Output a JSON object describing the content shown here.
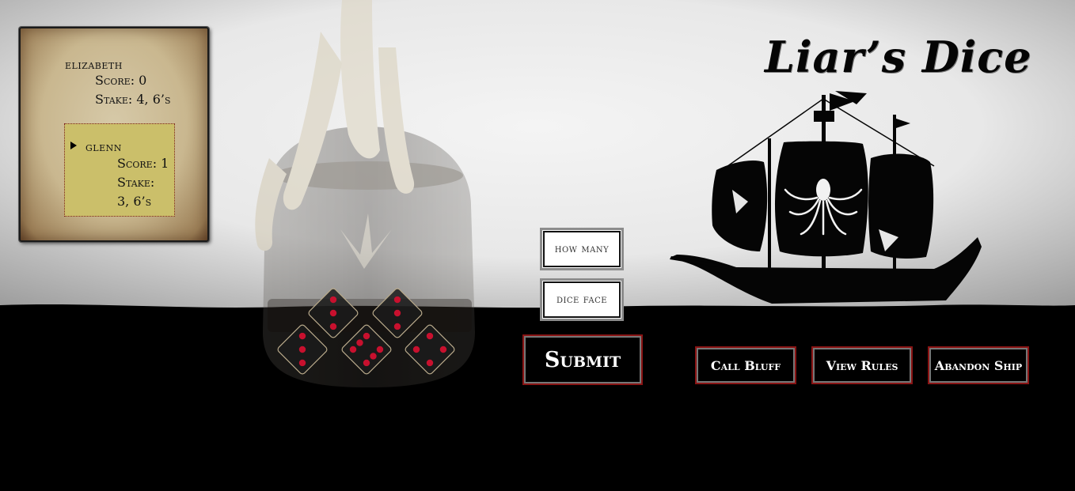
{
  "title": "Liar’s Dice",
  "players": [
    {
      "name": "elizabeth",
      "score_line": "Score: 0",
      "stake_label": "Stake:",
      "stake_value": "4, 6’s",
      "active": false
    },
    {
      "name": "glenn",
      "score_line": "Score: 1",
      "stake_label": "Stake:",
      "stake_value": "3, 6’s",
      "active": true
    }
  ],
  "bid": {
    "how_many_placeholder": "how many",
    "dice_face_placeholder": "dice face",
    "submit_label": "Submit"
  },
  "actions": {
    "call_bluff": "Call Bluff",
    "view_rules": "View Rules",
    "abandon_ship": "Abandon Ship"
  },
  "dice": [
    {
      "value": 3
    },
    {
      "value": 3
    },
    {
      "value": 3
    },
    {
      "value": 6
    },
    {
      "value": 4
    }
  ],
  "icons": {
    "turn": "turn-arrow-icon",
    "ship": "pirate-ship-icon",
    "kraken": "kraken-emblem-icon",
    "bottle": "skeleton-hand-bottle-icon"
  },
  "colors": {
    "sky_top": "#b9b9b9",
    "sky_mid": "#f0f0f0",
    "sea": "#000000",
    "parchment": "#cbb993",
    "active_player": "#cbbf6a",
    "button_border": "#8a1414",
    "pip": "#c8102e"
  }
}
